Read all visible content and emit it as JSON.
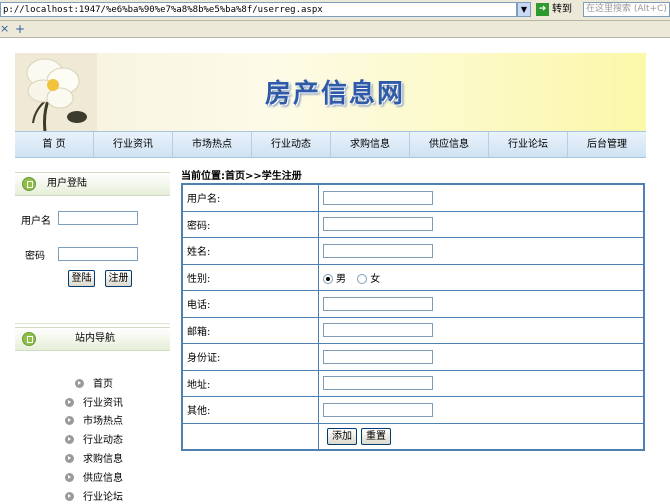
{
  "browser": {
    "address": "p://localhost:1947/%e6%ba%90%e7%a8%8b%e5%ba%8f/userreg.aspx",
    "go_label": "转到",
    "search_placeholder": "在这里搜索 (Alt+C)",
    "tab_close": "×",
    "tab_new": "+"
  },
  "header": {
    "site_title": "房产信息网"
  },
  "nav": [
    "首 页",
    "行业资讯",
    "市场热点",
    "行业动态",
    "求购信息",
    "供应信息",
    "行业论坛",
    "后台管理"
  ],
  "login": {
    "title": "用户登陆",
    "username_label": "用户名",
    "password_label": "密码",
    "login_button": "登陆",
    "register_button": "注册"
  },
  "site_nav": {
    "title": "站内导航",
    "items": [
      "首页",
      "行业资讯",
      "市场热点",
      "行业动态",
      "求购信息",
      "供应信息",
      "行业论坛"
    ]
  },
  "breadcrumb": "当前位置:首页>>学生注册",
  "form": {
    "fields": [
      {
        "label": "用户名:"
      },
      {
        "label": "密码:"
      },
      {
        "label": "姓名:"
      },
      {
        "label": "性别:"
      },
      {
        "label": "电话:"
      },
      {
        "label": "邮箱:"
      },
      {
        "label": "身份证:"
      },
      {
        "label": "地址:"
      },
      {
        "label": "其他:"
      }
    ],
    "gender_male": "男",
    "gender_female": "女",
    "add_button": "添加",
    "reset_button": "重置"
  }
}
